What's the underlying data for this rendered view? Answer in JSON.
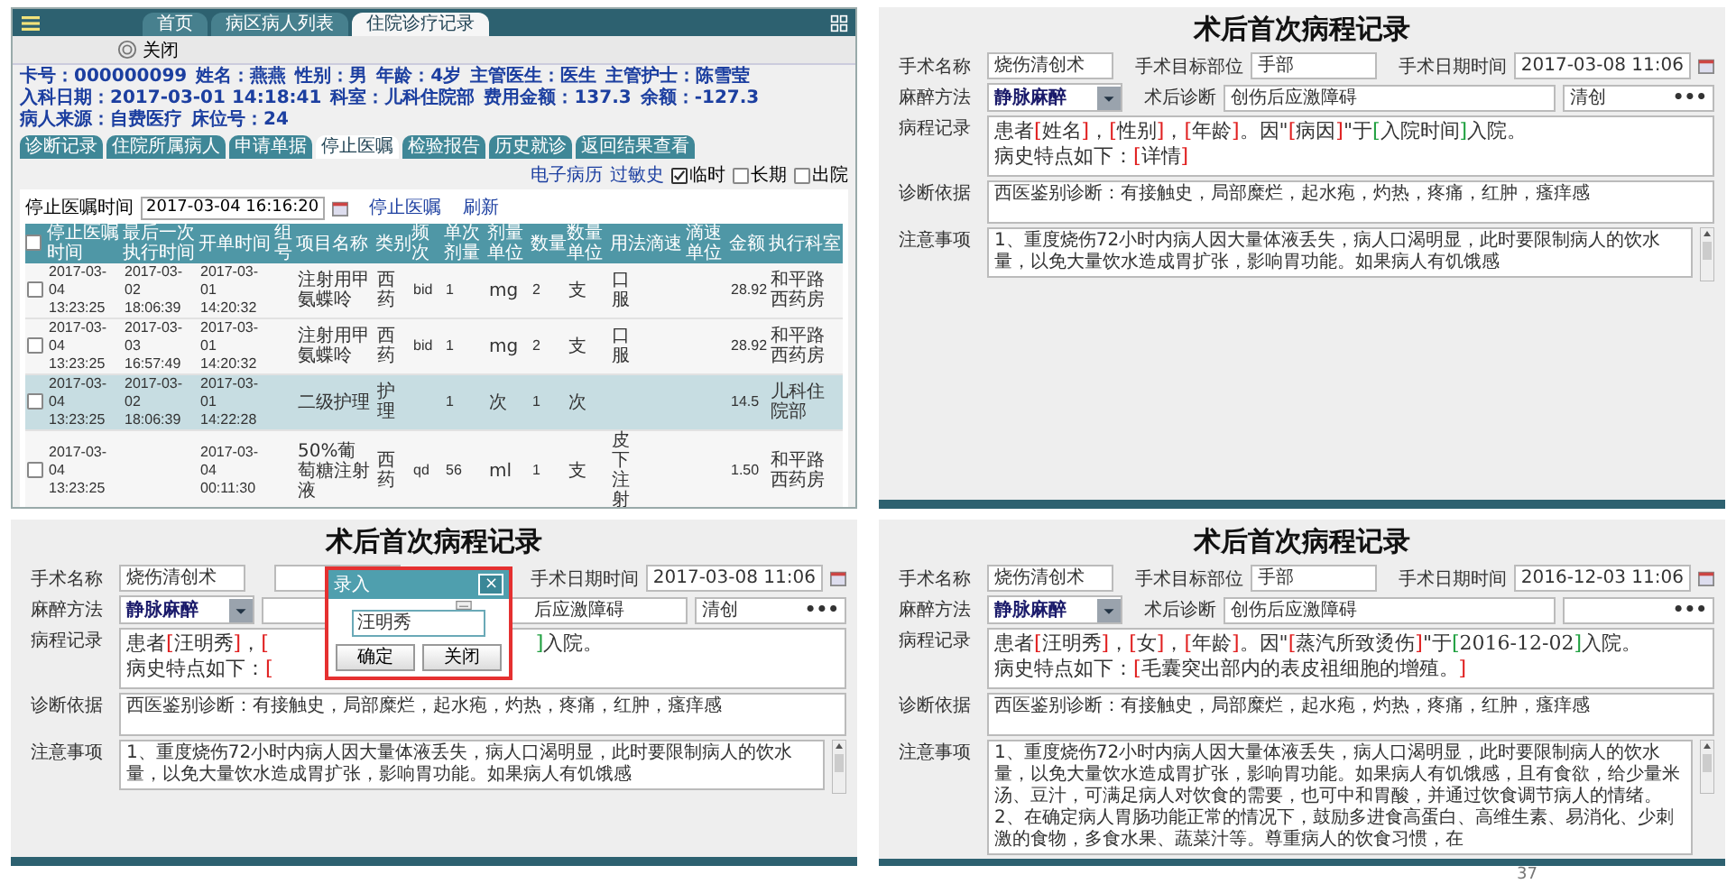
{
  "his": {
    "top_tabs": [
      {
        "label": "首页",
        "selected": false
      },
      {
        "label": "病区病人列表",
        "selected": false
      },
      {
        "label": "住院诊疗记录",
        "selected": true
      }
    ],
    "close_button": "关闭",
    "info": [
      "卡号：000000099",
      "姓名：燕燕",
      "性别：男",
      "年龄：4岁",
      "主管医生：医生",
      "主管护士：陈雪莹",
      "入科日期：2017-03-01 14:18:41",
      "科室：儿科住院部",
      "费用金额：137.3",
      "余额：-127.3",
      "病人来源：自费医疗",
      "床位号：24"
    ],
    "tabs": [
      {
        "label": "诊断记录",
        "selected": false
      },
      {
        "label": "住院所属病人",
        "selected": false
      },
      {
        "label": "申请单据",
        "selected": false
      },
      {
        "label": "停止医嘱",
        "selected": true
      },
      {
        "label": "检验报告",
        "selected": false
      },
      {
        "label": "历史就诊",
        "selected": false
      },
      {
        "label": "返回结果查看",
        "selected": false
      }
    ],
    "links": [
      "电子病历",
      "过敏史"
    ],
    "checks": [
      {
        "label": "临时",
        "checked": true
      },
      {
        "label": "长期",
        "checked": false
      },
      {
        "label": "出院",
        "checked": false
      }
    ],
    "filter_label": "停止医嘱时间",
    "filter_value": "2017-03-04 16:16:20",
    "actions": [
      "停止医嘱",
      "刷新"
    ],
    "all_checked": false,
    "columns": [
      "停止医嘱时间",
      "最后一次执行时间",
      "开单时间",
      "组号",
      "项目名称",
      "类别",
      "频次",
      "单次剂量",
      "剂量单位",
      "数量",
      "数量单位",
      "用法",
      "滴速",
      "滴速单位",
      "金额",
      "执行科室"
    ],
    "rows": [
      {
        "checked": false,
        "selected": false,
        "cells": [
          "2017-03-04 13:23:25",
          "2017-03-02 18:06:39",
          "2017-03-01 14:20:32",
          "",
          "注射用甲氨蝶呤",
          "西药",
          "bid",
          "1",
          "mg",
          "2",
          "支",
          "口服",
          "",
          "",
          "28.92",
          "和平路西药房"
        ]
      },
      {
        "checked": false,
        "selected": false,
        "cells": [
          "2017-03-04 13:23:25",
          "2017-03-03 16:57:49",
          "2017-03-01 14:20:32",
          "",
          "注射用甲氨蝶呤",
          "西药",
          "bid",
          "1",
          "mg",
          "2",
          "支",
          "口服",
          "",
          "",
          "28.92",
          "和平路西药房"
        ]
      },
      {
        "checked": false,
        "selected": true,
        "cells": [
          "2017-03-04 13:23:25",
          "2017-03-02 18:06:39",
          "2017-03-01 14:22:28",
          "",
          "二级护理",
          "护理",
          "",
          "1",
          "次",
          "1",
          "次",
          "",
          "",
          "",
          "14.5",
          "儿科住院部"
        ]
      },
      {
        "checked": false,
        "selected": false,
        "cells": [
          "2017-03-04 13:23:25",
          "",
          "2017-03-04 00:11:30",
          "",
          "50%葡萄糖注射液",
          "西药",
          "qd",
          "56",
          "ml",
          "1",
          "支",
          "皮下注射",
          "",
          "",
          "1.50",
          "和平路西药房"
        ]
      }
    ]
  },
  "forms": [
    {
      "title": "术后首次病程记录",
      "row1": [
        {
          "label": "手术名称",
          "value": "烧伤清创术",
          "kind": "text"
        },
        {
          "label": "手术目标部位",
          "value": "手部",
          "kind": "text"
        },
        {
          "label": "手术日期时间",
          "value": "2017-03-08 11:06",
          "kind": "date"
        }
      ],
      "anesthesia_label": "麻醉方法",
      "anesthesia": "静脉麻醉",
      "diagnosis_label": "术后诊断",
      "diagnosis": "创伤后应激障碍",
      "lookup_value": "清创",
      "lookup_button": "•••",
      "record_label": "病程记录",
      "record_lines": [
        [
          [
            {
              "text": "患者"
            },
            {
              "text": "[",
              "color": "#e02020"
            },
            {
              "text": "姓名"
            },
            {
              "text": "]",
              "color": "#e02020"
            },
            {
              "text": "，"
            },
            {
              "text": "[",
              "color": "#e02020"
            },
            {
              "text": "性别"
            },
            {
              "text": "]",
              "color": "#e02020"
            },
            {
              "text": "，"
            },
            {
              "text": "[",
              "color": "#e02020"
            },
            {
              "text": "年龄"
            },
            {
              "text": "]",
              "color": "#e02020"
            },
            {
              "text": "。因\""
            },
            {
              "text": "[",
              "color": "#e02020"
            },
            {
              "text": "病因"
            },
            {
              "text": "]",
              "color": "#e02020"
            },
            {
              "text": "\"于"
            },
            {
              "text": "[",
              "color": "#20a040"
            },
            {
              "text": "入院时间"
            },
            {
              "text": "]",
              "color": "#20a040"
            },
            {
              "text": "入院。"
            }
          ]
        ],
        [
          [
            {
              "text": "病史特点如下："
            },
            {
              "text": "[",
              "color": "#e02020"
            },
            {
              "text": "详情"
            },
            {
              "text": "]",
              "color": "#e02020"
            }
          ]
        ]
      ],
      "basis_label": "诊断依据",
      "basis": "西医鉴别诊断：有接触史，局部糜烂，起水疱，灼热，疼痛，红肿，瘙痒感",
      "notes_label": "注意事项",
      "notes": [
        "1、重度烧伤72小时内病人因大量体液丢失，病人口渴明显，此时要限制病人的饮水量，以免大量饮水造成胃扩张，影响胃功能。如果病人有饥饿感"
      ]
    },
    {
      "title": "术后首次病程记录",
      "row1": [
        {
          "label": "手术名称",
          "value": "烧伤清创术",
          "kind": "text"
        },
        {
          "kind": "text"
        },
        {
          "label": "手术日期时间",
          "value": "2017-03-08 11:06",
          "kind": "date"
        }
      ],
      "anesthesia_label": "麻醉方法",
      "anesthesia": "静脉麻醉",
      "diagnosis": "后应激障碍",
      "lookup_value": "清创",
      "lookup_button": "•••",
      "record_label": "病程记录",
      "record_lines": [
        [
          [
            {
              "text": "患者"
            },
            {
              "text": "[",
              "color": "#e02020"
            },
            {
              "text": "汪明秀"
            },
            {
              "text": "]",
              "color": "#e02020"
            },
            {
              "text": "，"
            },
            {
              "text": "[",
              "color": "#e02020"
            }
          ],
          [
            {
              "text": "]",
              "color": "#20a040"
            },
            {
              "text": "入院。"
            }
          ]
        ],
        [
          [
            {
              "text": "病史特点如下："
            },
            {
              "text": "[",
              "color": "#e02020"
            }
          ]
        ]
      ],
      "basis_label": "诊断依据",
      "basis": "西医鉴别诊断：有接触史，局部糜烂，起水疱，灼热，疼痛，红肿，瘙痒感",
      "notes_label": "注意事项",
      "notes": [
        "1、重度烧伤72小时内病人因大量体液丢失，病人口渴明显，此时要限制病人的饮水量，以免大量饮水造成胃扩张，影响胃功能。如果病人有饥饿感"
      ],
      "dialog": {
        "title": "录入",
        "close": "×",
        "value": "汪明秀",
        "buttons": [
          "确定",
          "关闭"
        ]
      }
    },
    {
      "title": "术后首次病程记录",
      "row1": [
        {
          "label": "手术名称",
          "value": "烧伤清创术",
          "kind": "text"
        },
        {
          "label": "手术目标部位",
          "value": "手部",
          "kind": "text"
        },
        {
          "label": "手术日期时间",
          "value": "2016-12-03 11:06",
          "kind": "date"
        }
      ],
      "anesthesia_label": "麻醉方法",
      "anesthesia": "静脉麻醉",
      "diagnosis_label": "术后诊断",
      "diagnosis": "创伤后应激障碍",
      "lookup_button": "•••",
      "record_label": "病程记录",
      "record_lines": [
        [
          [
            {
              "text": "患者"
            },
            {
              "text": "[",
              "color": "#e02020"
            },
            {
              "text": "汪明秀"
            },
            {
              "text": "]",
              "color": "#e02020"
            },
            {
              "text": "，"
            },
            {
              "text": "[",
              "color": "#e02020"
            },
            {
              "text": "女"
            },
            {
              "text": "]",
              "color": "#e02020"
            },
            {
              "text": "，"
            },
            {
              "text": "[",
              "color": "#e02020"
            },
            {
              "text": "年龄"
            },
            {
              "text": "]",
              "color": "#e02020"
            },
            {
              "text": "。因\""
            },
            {
              "text": "[",
              "color": "#e02020"
            },
            {
              "text": "蒸汽所致烫伤"
            },
            {
              "text": "]",
              "color": "#e02020"
            },
            {
              "text": "\"于"
            },
            {
              "text": "[",
              "color": "#20a040"
            },
            {
              "text": "2016-12-02"
            },
            {
              "text": "]",
              "color": "#20a040"
            },
            {
              "text": "入院。"
            }
          ]
        ],
        [
          [
            {
              "text": "病史特点如下："
            },
            {
              "text": "[",
              "color": "#e02020"
            },
            {
              "text": "毛囊突出部内的表皮祖细胞的增殖。"
            },
            {
              "text": "]",
              "color": "#e02020"
            }
          ]
        ]
      ],
      "basis_label": "诊断依据",
      "basis": "西医鉴别诊断：有接触史，局部糜烂，起水疱，灼热，疼痛，红肿，瘙痒感",
      "notes_label": "注意事项",
      "notes": [
        "1、重度烧伤72小时内病人因大量体液丢失，病人口渴明显，此时要限制病人的饮水量，以免大量饮水造成胃扩张，影响胃功能。如果病人有饥饿感，且有食欲，给少量米汤、豆汁，可满足病人对饮食的需要，也可中和胃酸，并通过饮食调节病人的情绪。",
        "2、在确定病人胃肠功能正常的情况下，鼓励多进食高蛋白、高维生素、易消化、少刺激的食物，多食水果、蔬菜汁等。尊重病人的饮食习惯，在"
      ]
    }
  ],
  "page_number": "37"
}
